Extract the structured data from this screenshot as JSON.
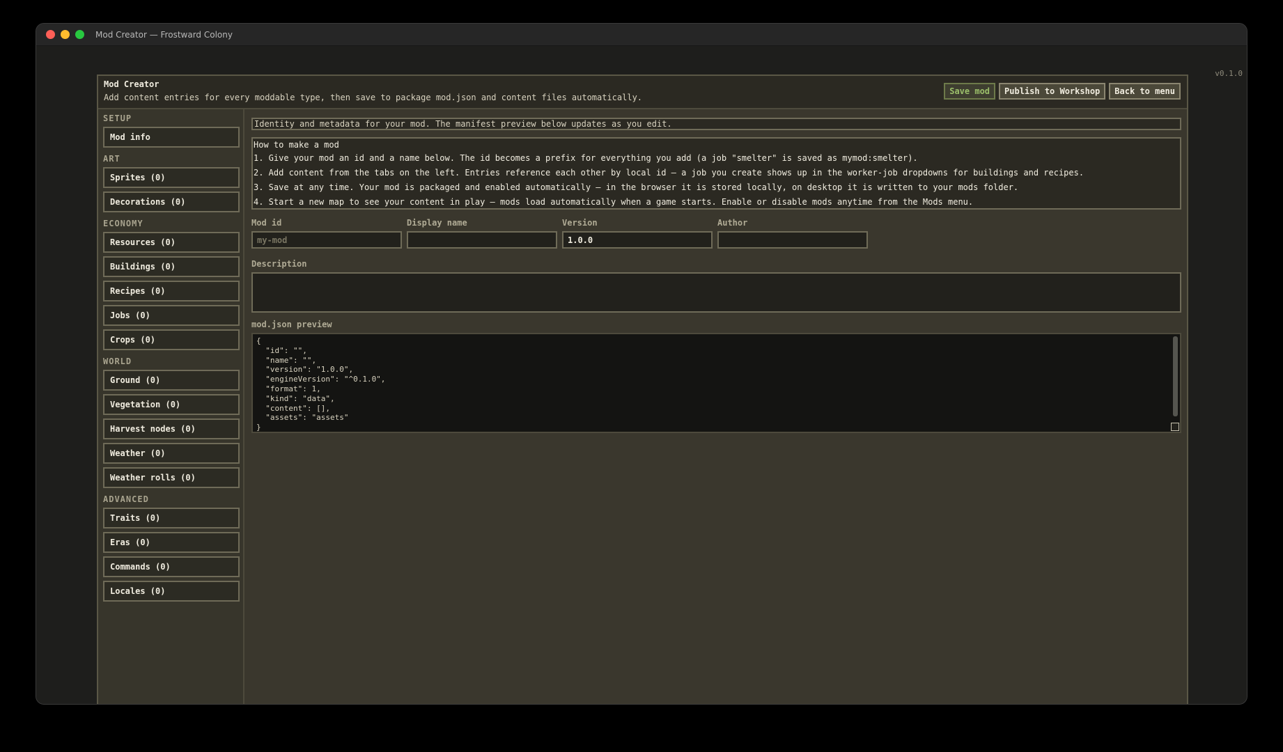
{
  "window": {
    "title": "Mod Creator — Frostward Colony",
    "version": "v0.1.0"
  },
  "header": {
    "title": "Mod Creator",
    "subtitle": "Add content entries for every moddable type, then save to package mod.json and content files automatically.",
    "buttons": {
      "save": "Save mod",
      "publish": "Publish to Workshop",
      "back": "Back to menu"
    }
  },
  "sidebar": {
    "groups": [
      {
        "label": "SETUP",
        "items": [
          "Mod info"
        ]
      },
      {
        "label": "ART",
        "items": [
          "Sprites (0)",
          "Decorations (0)"
        ]
      },
      {
        "label": "ECONOMY",
        "items": [
          "Resources (0)",
          "Buildings (0)",
          "Recipes (0)",
          "Jobs (0)",
          "Crops (0)"
        ]
      },
      {
        "label": "WORLD",
        "items": [
          "Ground (0)",
          "Vegetation (0)",
          "Harvest nodes (0)",
          "Weather (0)",
          "Weather rolls (0)"
        ]
      },
      {
        "label": "ADVANCED",
        "items": [
          "Traits (0)",
          "Eras (0)",
          "Commands (0)",
          "Locales (0)"
        ]
      }
    ]
  },
  "main": {
    "intro": "Identity and metadata for your mod. The manifest preview below updates as you edit.",
    "howto": {
      "title": "How to make a mod",
      "steps": [
        "1. Give your mod an id and a name below. The id becomes a prefix for everything you add (a job \"smelter\" is saved as mymod:smelter).",
        "2. Add content from the tabs on the left. Entries reference each other by local id — a job you create shows up in the worker-job dropdowns for buildings and recipes.",
        "3. Save at any time. Your mod is packaged and enabled automatically — in the browser it is stored locally, on desktop it is written to your mods folder.",
        "4. Start a new map to see your content in play — mods load automatically when a game starts. Enable or disable mods anytime from the Mods menu."
      ]
    },
    "fields": {
      "mod_id": {
        "label": "Mod id",
        "value": "",
        "placeholder": "my-mod"
      },
      "display_name": {
        "label": "Display name",
        "value": "",
        "placeholder": ""
      },
      "version": {
        "label": "Version",
        "value": "1.0.0",
        "placeholder": ""
      },
      "author": {
        "label": "Author",
        "value": "",
        "placeholder": ""
      }
    },
    "description": {
      "label": "Description",
      "value": ""
    },
    "preview": {
      "label": "mod.json preview",
      "lines": [
        "{",
        "  \"id\": \"\",",
        "  \"name\": \"\",",
        "  \"version\": \"1.0.0\",",
        "  \"engineVersion\": \"^0.1.0\",",
        "  \"format\": 1,",
        "  \"kind\": \"data\",",
        "  \"content\": [],",
        "  \"assets\": \"assets\"",
        "}"
      ]
    }
  }
}
